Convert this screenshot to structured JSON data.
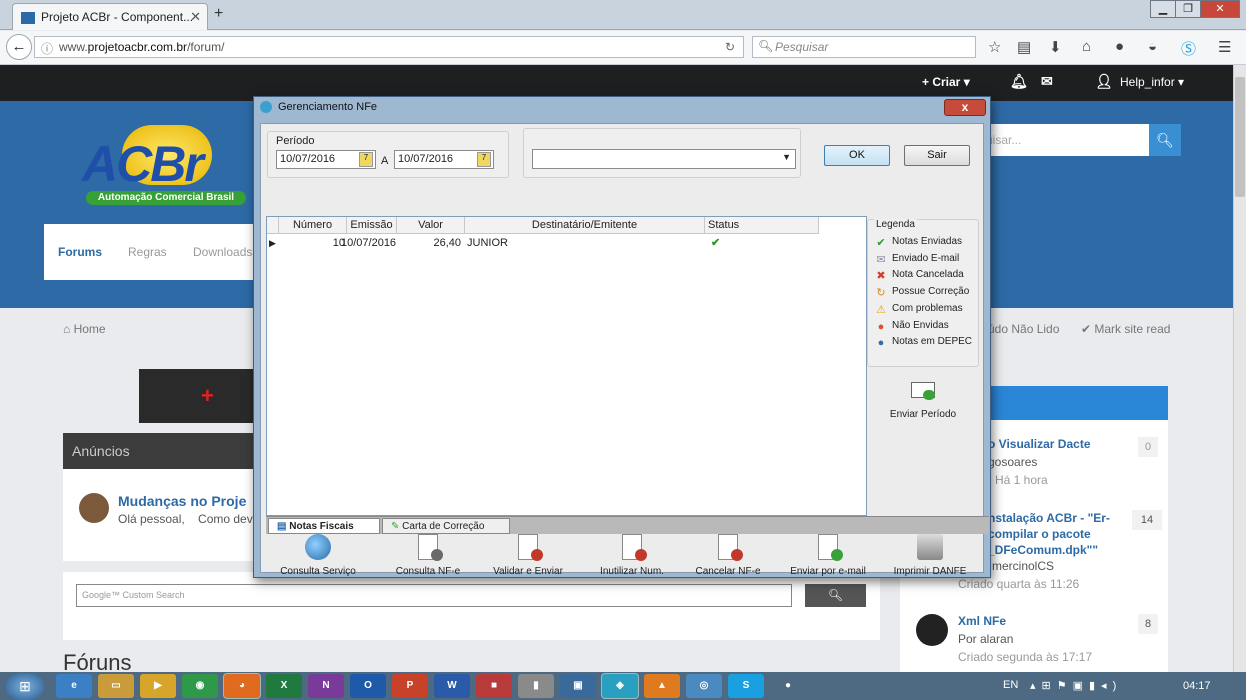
{
  "browser": {
    "tab_title": "Projeto ACBr - Component...",
    "url_prefix": "www.",
    "url_domain": "projetoacbr.com.br",
    "url_path": "/forum/",
    "search_placeholder": "Pesquisar"
  },
  "site": {
    "topbar": {
      "create_label": "+ Criar ▾",
      "user_label": "Help_infor ▾"
    },
    "logo_text": "ACBr",
    "logo_tagline": "Automação Comercial Brasil",
    "nav": [
      "Forums",
      "Regras",
      "Downloads"
    ],
    "search_placeholder": "uisar...",
    "breadcrumb_home": "Home",
    "unread_label": "údo Não Lido",
    "mark_read_label": "Mark site read",
    "announcements_title": "Anúncios",
    "announcement_title": "Mudanças no Proje",
    "announcement_snippet": "Olá pessoal,    Como dev",
    "google_label": "Google™ Custom Search",
    "forums_heading": "Fóruns",
    "recent": [
      {
        "title": "o Visualizar Dacte",
        "author": "gosoares",
        "time": "Há 1 hora",
        "count": "0"
      },
      {
        "title": "nstalação ACBr - \"Er-compilar o pacote _DFeComum.dpk\"\"",
        "author": "mercinolCS",
        "time": "Criado quarta às 11:26",
        "count": "14"
      },
      {
        "title": "Xml NFe",
        "author": "Por alaran",
        "time": "Criado segunda às 17:17",
        "count": "8"
      }
    ]
  },
  "dialog": {
    "title": "Gerenciamento NFe",
    "close_label": "x",
    "period_label": "Período",
    "date_from": "10/07/2016",
    "date_sep": "A",
    "date_to": "10/07/2016",
    "filter_value": "",
    "ok_label": "OK",
    "exit_label": "Sair",
    "columns": [
      "Número",
      "Emissão",
      "Valor",
      "Destinatário/Emitente",
      "Status"
    ],
    "rows": [
      {
        "numero": "10",
        "emissao": "10/07/2016",
        "valor": "26,40",
        "destinatario": "JUNIOR",
        "status": "✔"
      }
    ],
    "legend_title": "Legenda",
    "legend": [
      {
        "label": "Notas Enviadas",
        "icon": "check-icon",
        "color": "#2a9a2a",
        "glyph": "✔"
      },
      {
        "label": "Enviado E-mail",
        "icon": "envelope-icon",
        "color": "#8a8fa8",
        "glyph": "✉"
      },
      {
        "label": "Nota Cancelada",
        "icon": "cross-icon",
        "color": "#d43b2a",
        "glyph": "✖"
      },
      {
        "label": "Possue Correção",
        "icon": "correction-icon",
        "color": "#d98a1e",
        "glyph": "↻"
      },
      {
        "label": "Com problemas",
        "icon": "warning-icon",
        "color": "#e0a800",
        "glyph": "⚠"
      },
      {
        "label": "Não Envidas",
        "icon": "not-sent-icon",
        "color": "#e05030",
        "glyph": "●"
      },
      {
        "label": "Notas em DEPEC",
        "icon": "globe-icon",
        "color": "#2f6fb0",
        "glyph": "●"
      }
    ],
    "send_period_label": "Enviar Período",
    "tabs": [
      "Notas Fiscais",
      "Carta de Correção"
    ],
    "toolbar": [
      {
        "label": "Consulta Serviço",
        "icon": "globe-search-icon"
      },
      {
        "label": "Consulta NF-e",
        "icon": "document-search-icon"
      },
      {
        "label": "Validar e Enviar",
        "icon": "document-send-icon"
      },
      {
        "label": "Inutilizar Num.",
        "icon": "document-block-icon"
      },
      {
        "label": "Cancelar NF-e",
        "icon": "document-cancel-icon"
      },
      {
        "label": "Enviar por e-mail",
        "icon": "email-send-icon"
      },
      {
        "label": "Imprimir DANFE",
        "icon": "printer-icon"
      }
    ]
  },
  "taskbar": {
    "lang": "EN",
    "time": "04:17"
  }
}
